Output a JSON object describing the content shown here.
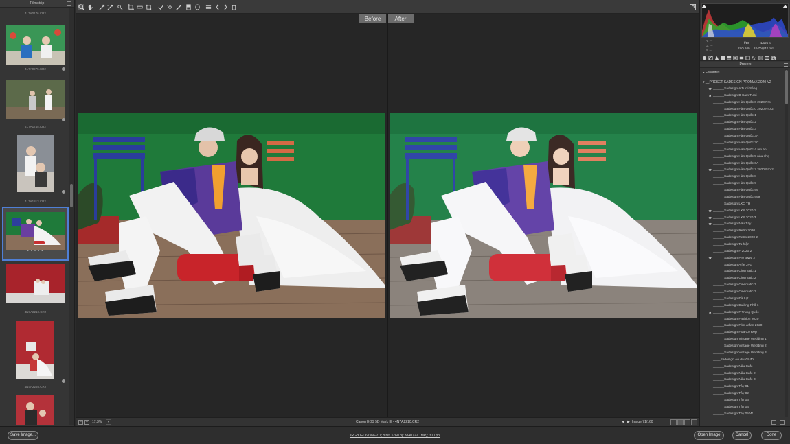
{
  "filmstrip": {
    "title": "Filmstrip",
    "items": [
      {
        "name": "4L7A0176.CR2",
        "selected": false
      },
      {
        "name": "4L7A0975.CR2",
        "selected": false
      },
      {
        "name": "4L7A1745.CR2",
        "selected": false
      },
      {
        "name": "4L7A1813.CR2",
        "selected": false
      },
      {
        "name": "4N7A2210.CR2",
        "selected": true,
        "rating_dots": "• • • • •"
      },
      {
        "name": "4N7A2265.CR2",
        "selected": false
      },
      {
        "name": "4N7A2271.CR2",
        "selected": false
      },
      {
        "name": "",
        "selected": false
      }
    ]
  },
  "toolbar": {
    "tools": [
      "zoom-icon",
      "hand-icon",
      "white-balance-icon",
      "color-sampler-icon",
      "targeted-adjustment-icon",
      "crop-icon",
      "straighten-icon",
      "transform-icon",
      "spot-removal-icon",
      "red-eye-icon",
      "adjustment-brush-icon",
      "graduated-filter-icon",
      "radial-filter-icon",
      "preferences-icon",
      "rotate-left-icon",
      "rotate-right-icon",
      "delete-icon"
    ],
    "fullscreen_icon": "fullscreen-icon"
  },
  "compare": {
    "before_label": "Before",
    "after_label": "After"
  },
  "statusbar": {
    "zoom": "17.3%",
    "zoom_arrow": "▾",
    "camera_and_file": "Canon EOS 5D Mark III  -  4N7A2210.CR2",
    "image_counter": "Image 71/160",
    "prev": "◀",
    "next": "▶"
  },
  "histogram": {
    "rgb": {
      "r": "R:  ---",
      "g": "G:  ---",
      "b": "B:  ---"
    },
    "exif": {
      "aperture": "f/10",
      "shutter": "1/125 s",
      "iso": "ISO 100",
      "lens": "24-70@42 mm"
    }
  },
  "presets": {
    "title": "Presets",
    "favorites_label": "Favorites",
    "group_label": "__PRESET SADESIGN PROMAX 2020 V2",
    "items": [
      {
        "label": "______Sadesign A Tươi Sáng",
        "star": true
      },
      {
        "label": "______Sadesign B  Cam Tươi",
        "star": true
      },
      {
        "label": "______Sadesign Hàn Quốc 0 2020 Pro",
        "star": false
      },
      {
        "label": "______Sadesign Hàn Quốc 0 2020 Pro 2",
        "star": false
      },
      {
        "label": "______Sadesign Hàn Quốc 1",
        "star": false
      },
      {
        "label": "______Sadesign Hàn Quốc 2",
        "star": false
      },
      {
        "label": "______Sadesign Hàn Quốc 3",
        "star": false
      },
      {
        "label": "______Sadesign Hàn Quốc 3A",
        "star": false
      },
      {
        "label": "______Sadesign Hàn Quốc 3C",
        "star": false
      },
      {
        "label": "______Sadesign Hàn Quốc 4 âm áp",
        "star": false
      },
      {
        "label": "______Sadesign Hàn Quốc 5 nâu nhẹ",
        "star": false
      },
      {
        "label": "______Sadesign Hàn Quốc 6A",
        "star": false
      },
      {
        "label": "______Sadesign Hàn Quốc 7 2020 Pro 2",
        "star": true
      },
      {
        "label": "______Sadesign Hàn Quốc 8",
        "star": false
      },
      {
        "label": "______Sadesign Hàn Quốc 9",
        "star": false
      },
      {
        "label": "______Sadesign Hàn Quốc 99",
        "star": false
      },
      {
        "label": "______Sadesign Hàn Quốc 999",
        "star": false
      },
      {
        "label": "______Sadesign LXC  TH",
        "star": false
      },
      {
        "label": "______Sadesign LXS 2020 1",
        "star": true
      },
      {
        "label": "______Sadesign LXS 2020 3",
        "star": true
      },
      {
        "label": "______Sadesign Nâu Tây",
        "star": true
      },
      {
        "label": "______Sadesign Retro 2020",
        "star": false
      },
      {
        "label": "______Sadesign Retro 2020 2",
        "star": false
      },
      {
        "label": "______Sadesign Ta hiện",
        "star": false
      },
      {
        "label": "______Sadesign  F 2020 2",
        "star": false
      },
      {
        "label": "______Sadesign  Pro B&W 2",
        "star": true
      },
      {
        "label": "______Sadesign  A ffe JPG",
        "star": false
      },
      {
        "label": "______Sadesign Cinematic 1",
        "star": false
      },
      {
        "label": "______Sadesign Cinematic 2",
        "star": false
      },
      {
        "label": "______Sadesign Cinematic 3",
        "star": false
      },
      {
        "label": "______Sadesign Cinematic 3",
        "star": false
      },
      {
        "label": "______Sadesign Đà Lạt",
        "star": false
      },
      {
        "label": "______Sadesign Đường Phố 1",
        "star": false
      },
      {
        "label": "______Sadesign F Trung Quốc",
        "star": true
      },
      {
        "label": "______Sadesign Fashion 2020",
        "star": false
      },
      {
        "label": "______Sadesign Film Jafan 2020",
        "star": false
      },
      {
        "label": "______Sadesign Hoa Cỏ Đẹp",
        "star": false
      },
      {
        "label": "______Sadesign Vintage Wedding 1",
        "star": false
      },
      {
        "label": "______Sadesign Vintage Wedding 2",
        "star": false
      },
      {
        "label": "______Sadesign Vintage Wedding 3",
        "star": false
      },
      {
        "label": "____Sadesign Áo dài đỏ đô",
        "star": false
      },
      {
        "label": "______Sadesign Nâu Cafe",
        "star": false
      },
      {
        "label": "______Sadesign Nâu Cafe 2",
        "star": false
      },
      {
        "label": "______Sadesign Nâu Cafe 3",
        "star": false
      },
      {
        "label": "______Sadesign Tây 01",
        "star": false
      },
      {
        "label": "______Sadesign Tây 02",
        "star": false
      },
      {
        "label": "______Sadesign Tây 03",
        "star": false
      },
      {
        "label": "______Sadesign Tây 04",
        "star": false
      },
      {
        "label": "______Sadesign Tây 05 W",
        "star": false
      }
    ]
  },
  "bottom": {
    "save_label": "Save Image...",
    "workflow_link": "sRGB IEC61966-2.1; 8 bit; 5760 by 3840 (22.1MP); 300 ppi",
    "open_label": "Open Image",
    "cancel_label": "Cancel",
    "done_label": "Done"
  },
  "colors": {
    "accent": "#4f7fd6",
    "green_wall": "#1f7a3a",
    "floor": "#8a6f5a"
  }
}
